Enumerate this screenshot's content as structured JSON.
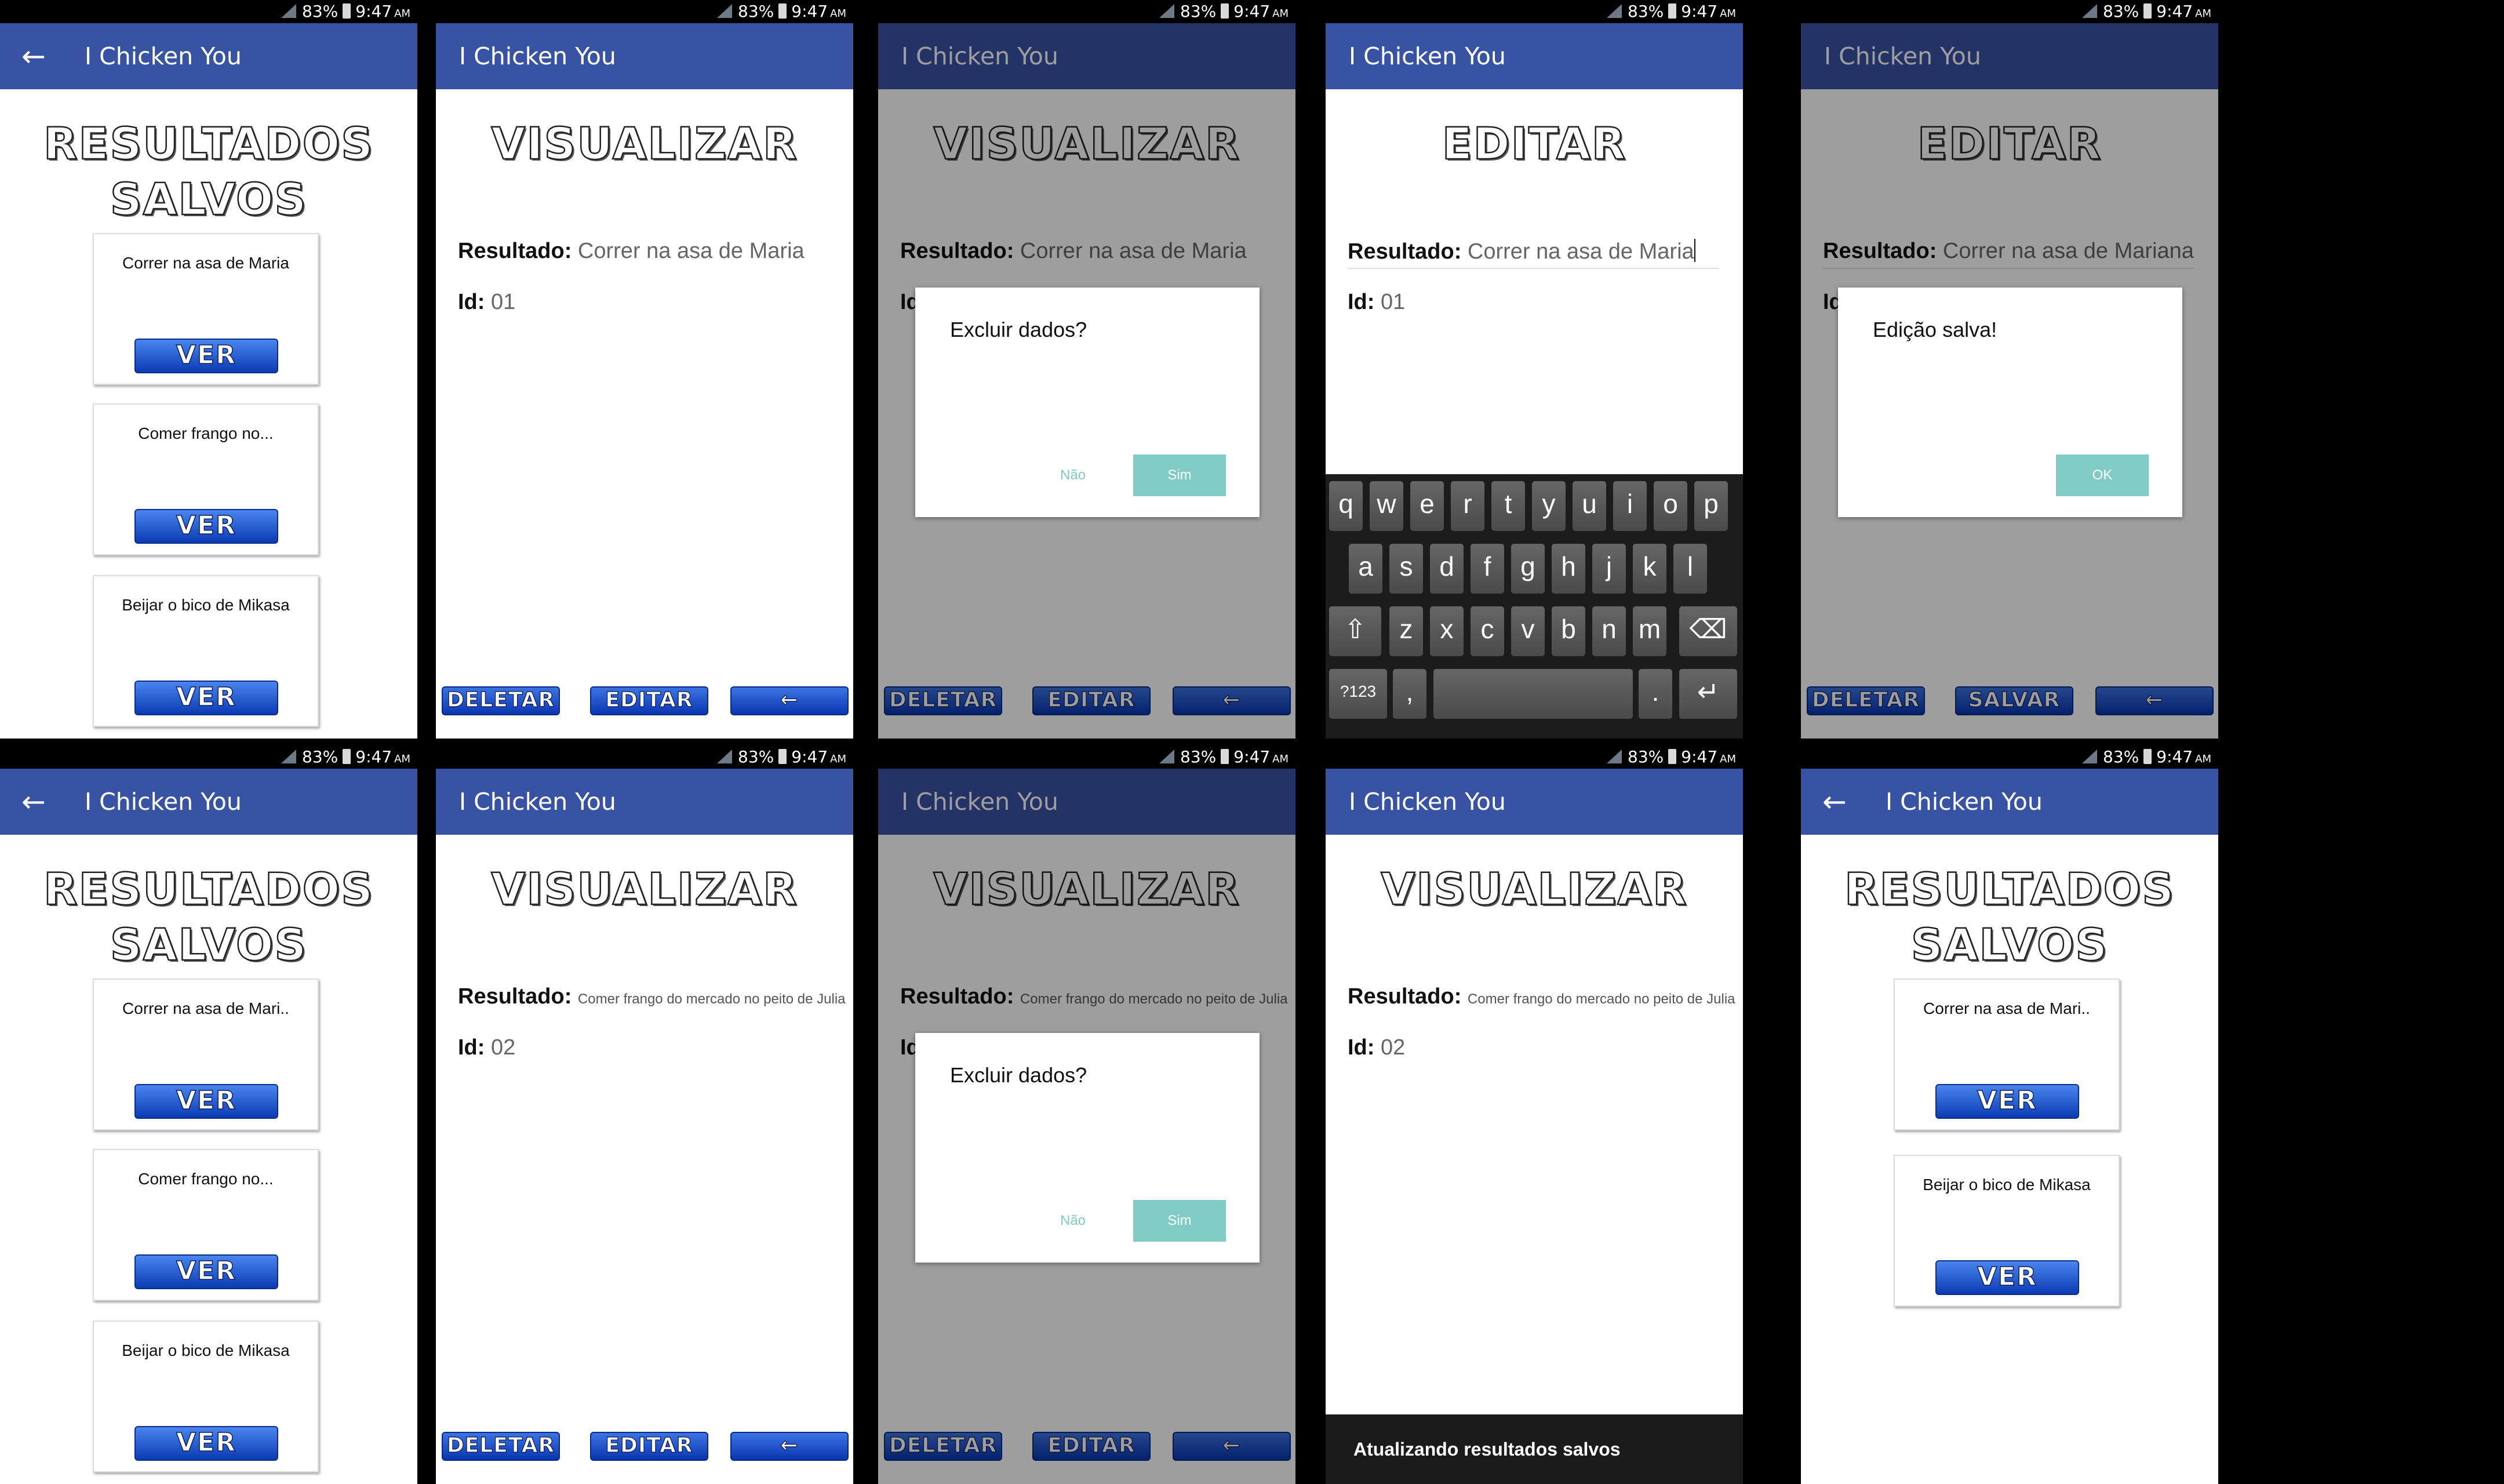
{
  "status": {
    "signal": "signal-icon",
    "battery_pct": "83%",
    "time": "9:47",
    "ampm": "AM"
  },
  "app": {
    "title": "I Chicken You",
    "back_arrow": "←"
  },
  "headings": {
    "results_l1": "RESULTADOS",
    "results_l2": "SALVOS",
    "view": "VISUALIZAR",
    "edit": "EDITAR"
  },
  "cards": {
    "maria": "Correr na asa de Maria",
    "maria_short": "Correr na asa de Mari..",
    "maria_short2": "Correr na asa de Mari..",
    "frango": "Comer frango no...",
    "mikasa": "Beijar o bico de Mikasa",
    "ver": "VER"
  },
  "fields": {
    "resultado_label": "Resultado:",
    "id_label": "Id:",
    "id_partial": "Id",
    "r1": "Correr na asa de Maria",
    "r2": "Comer frango do mercado no peito de Julia",
    "r_edited": "Correr na asa de Mariana",
    "id1": "01",
    "id2": "02"
  },
  "buttons": {
    "deletar": "DELETAR",
    "editar": "EDITAR",
    "salvar": "SALVAR",
    "voltar": "←"
  },
  "dialogs": {
    "excluir": "Excluir dados?",
    "nao": "Não",
    "sim": "Sim",
    "salva": "Edição salva!",
    "ok": "OK"
  },
  "snackbar": "Atualizando resultados salvos",
  "keyboard": {
    "row1": [
      "q",
      "w",
      "e",
      "r",
      "t",
      "y",
      "u",
      "i",
      "o",
      "p"
    ],
    "row2": [
      "a",
      "s",
      "d",
      "f",
      "g",
      "h",
      "j",
      "k",
      "l"
    ],
    "row3": [
      "z",
      "x",
      "c",
      "v",
      "b",
      "n",
      "m"
    ],
    "shift": "⇧",
    "backspace": "⌫",
    "num": "?123",
    "comma": ",",
    "period": ".",
    "enter": "↵"
  }
}
